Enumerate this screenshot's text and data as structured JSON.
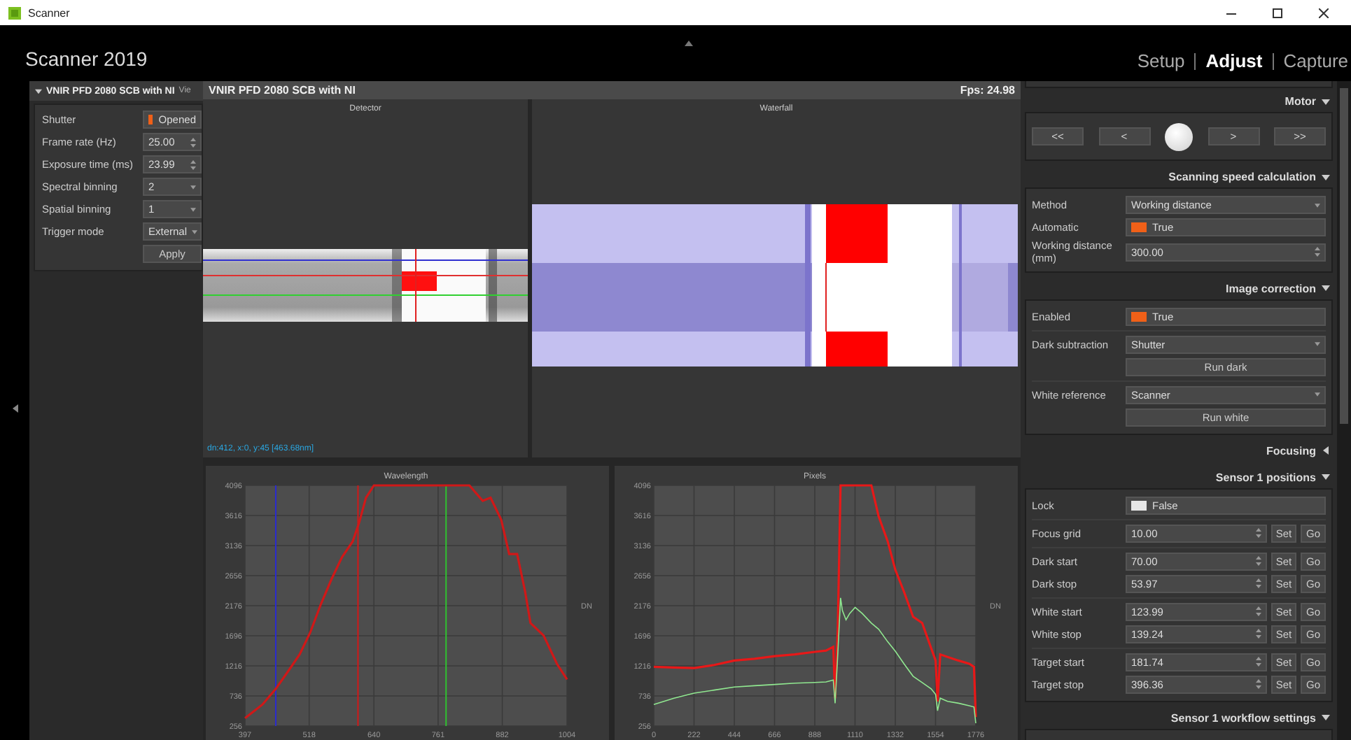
{
  "window": {
    "title": "Scanner"
  },
  "header": {
    "app_title": "Scanner 2019",
    "nav": [
      {
        "label": "Setup",
        "selected": false
      },
      {
        "label": "Adjust",
        "selected": true
      },
      {
        "label": "Capture",
        "selected": false
      }
    ]
  },
  "left_panel": {
    "title": "VNIR PFD 2080 SCB with NI",
    "title_overflow": "Vie",
    "expanded": true,
    "rows": [
      {
        "kind": "toggle",
        "label": "Shutter",
        "value": "Opened",
        "on": true
      },
      {
        "kind": "spin",
        "label": "Frame rate (Hz)",
        "value": "25.00"
      },
      {
        "kind": "spin",
        "label": "Exposure time (ms)",
        "value": "23.99"
      },
      {
        "kind": "dropdown",
        "label": "Spectral binning",
        "value": "2"
      },
      {
        "kind": "dropdown",
        "label": "Spatial binning",
        "value": "1"
      },
      {
        "kind": "dropdown",
        "label": "Trigger mode",
        "value": "External"
      },
      {
        "kind": "button",
        "label": "Apply"
      }
    ]
  },
  "viewer": {
    "title": "VNIR PFD 2080 SCB with NI",
    "fps": "Fps: 24.98",
    "views": [
      {
        "kind": "detector",
        "title": "Detector",
        "status": "dn:412, x:0, y:45 [463.68nm]"
      },
      {
        "kind": "waterfall",
        "title": "Waterfall"
      }
    ],
    "charts": [
      {
        "chart_data": {
          "type": "line",
          "title": "Wavelength",
          "ylabel": "DN",
          "xlim": [
            397,
            1004
          ],
          "ylim": [
            256,
            4096
          ],
          "xticks": [
            397,
            518,
            640,
            761,
            882,
            1004
          ],
          "yticks": [
            256,
            736,
            1216,
            1696,
            2176,
            2656,
            3136,
            3616,
            4096
          ],
          "x": [
            397,
            430,
            455,
            480,
            500,
            520,
            540,
            560,
            580,
            600,
            612,
            625,
            640,
            700,
            760,
            820,
            845,
            860,
            880,
            895,
            910,
            925,
            935,
            960,
            985,
            1004
          ],
          "series": [
            {
              "color": "#d01818",
              "values": [
                380,
                600,
                850,
                1150,
                1400,
                1750,
                2200,
                2600,
                2950,
                3200,
                3500,
                3900,
                4096,
                4096,
                4096,
                4096,
                3850,
                3900,
                3550,
                3000,
                3000,
                2400,
                1900,
                1700,
                1250,
                1000
              ]
            }
          ],
          "grid": true,
          "ref_lines": [
            {
              "axis": "x",
              "value": 455,
              "color": "#2a2ad0"
            },
            {
              "axis": "x",
              "value": 610,
              "color": "#d01818"
            },
            {
              "axis": "x",
              "value": 776,
              "color": "#30c030"
            }
          ]
        }
      },
      {
        "chart_data": {
          "type": "line",
          "title": "Pixels",
          "grid": true,
          "ylabel": "DN",
          "xlim": [
            0,
            1776
          ],
          "ylim": [
            256,
            4096
          ],
          "xticks": [
            0,
            222,
            444,
            666,
            888,
            1110,
            1332,
            1554,
            1776
          ],
          "yticks": [
            256,
            736,
            1216,
            1696,
            2176,
            2656,
            3136,
            3616,
            4096
          ],
          "x": [
            0,
            111,
            222,
            333,
            444,
            555,
            666,
            777,
            888,
            950,
            990,
            1000,
            1015,
            1030,
            1040,
            1060,
            1080,
            1110,
            1150,
            1200,
            1240,
            1290,
            1332,
            1380,
            1430,
            1480,
            1530,
            1554,
            1565,
            1580,
            1620,
            1680,
            1740,
            1766,
            1776
          ],
          "series": [
            {
              "color": "#e81818",
              "values": [
                1200,
                1190,
                1180,
                1230,
                1300,
                1330,
                1370,
                1400,
                1440,
                1460,
                1520,
                700,
                1800,
                4096,
                4096,
                4096,
                4096,
                4096,
                4096,
                4096,
                3600,
                3200,
                2750,
                2400,
                2000,
                1900,
                1500,
                1300,
                650,
                1400,
                1360,
                1300,
                1250,
                1200,
                400
              ]
            },
            {
              "color": "#90e890",
              "values": [
                600,
                700,
                780,
                830,
                880,
                900,
                920,
                940,
                950,
                960,
                990,
                620,
                1400,
                2300,
                2100,
                1950,
                2050,
                2150,
                2050,
                1900,
                1800,
                1600,
                1450,
                1250,
                1050,
                950,
                850,
                760,
                500,
                700,
                650,
                620,
                580,
                560,
                300
              ]
            }
          ]
        }
      }
    ]
  },
  "right_panel": {
    "sections": [
      {
        "kind": "motor",
        "title": "Motor",
        "expanded": true,
        "buttons": [
          "<<",
          "<",
          ">",
          ">>"
        ]
      },
      {
        "kind": "form",
        "title": "Scanning speed calculation",
        "expanded": true,
        "groups": [
          [
            {
              "kind": "dropdown",
              "label": "Method",
              "value": "Working distance"
            },
            {
              "kind": "toggle",
              "label": "Automatic",
              "value": "True",
              "on": true
            },
            {
              "kind": "spin",
              "label": "Working distance (mm)",
              "value": "300.00"
            }
          ]
        ]
      },
      {
        "kind": "form",
        "title": "Image correction",
        "expanded": true,
        "groups": [
          [
            {
              "kind": "toggle",
              "label": "Enabled",
              "value": "True",
              "on": true
            }
          ],
          [
            {
              "kind": "dropdown",
              "label": "Dark subtraction",
              "value": "Shutter"
            },
            {
              "kind": "button",
              "label": "Run dark"
            }
          ],
          [
            {
              "kind": "dropdown",
              "label": "White reference",
              "value": "Scanner"
            },
            {
              "kind": "button",
              "label": "Run white"
            }
          ]
        ]
      },
      {
        "kind": "form",
        "title": "Focusing",
        "expanded": false
      },
      {
        "kind": "form",
        "title": "Sensor 1 positions",
        "expanded": true,
        "groups": [
          [
            {
              "kind": "toggle",
              "label": "Lock",
              "value": "False",
              "on": false
            }
          ],
          [
            {
              "kind": "position",
              "label": "Focus grid",
              "value": "10.00",
              "actions": [
                "Set",
                "Go"
              ]
            }
          ],
          [
            {
              "kind": "position",
              "label": "Dark start",
              "value": "70.00",
              "actions": [
                "Set",
                "Go"
              ]
            },
            {
              "kind": "position",
              "label": "Dark stop",
              "value": "53.97",
              "actions": [
                "Set",
                "Go"
              ]
            }
          ],
          [
            {
              "kind": "position",
              "label": "White start",
              "value": "123.99",
              "actions": [
                "Set",
                "Go"
              ]
            },
            {
              "kind": "position",
              "label": "White stop",
              "value": "139.24",
              "actions": [
                "Set",
                "Go"
              ]
            }
          ],
          [
            {
              "kind": "position",
              "label": "Target start",
              "value": "181.74",
              "actions": [
                "Set",
                "Go"
              ]
            },
            {
              "kind": "position",
              "label": "Target stop",
              "value": "396.36",
              "actions": [
                "Set",
                "Go"
              ]
            }
          ]
        ]
      },
      {
        "kind": "form",
        "title": "Sensor 1 workflow settings",
        "expanded": true
      }
    ]
  }
}
